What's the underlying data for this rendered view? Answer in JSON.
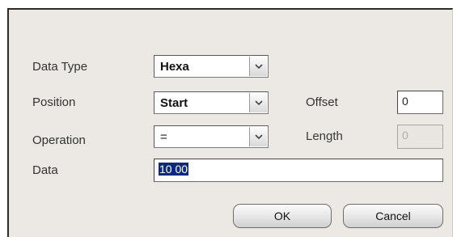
{
  "form": {
    "data_type": {
      "label": "Data Type",
      "value": "Hexa"
    },
    "position": {
      "label": "Position",
      "value": "Start"
    },
    "offset": {
      "label": "Offset",
      "value": "0"
    },
    "operation": {
      "label": "Operation",
      "value": "="
    },
    "length": {
      "label": "Length",
      "value": "0"
    },
    "data": {
      "label": "Data",
      "value": "10 00"
    }
  },
  "buttons": {
    "ok": "OK",
    "cancel": "Cancel"
  },
  "colors": {
    "dialog_bg": "#ece9e4",
    "selection": "#0f2a7a"
  }
}
